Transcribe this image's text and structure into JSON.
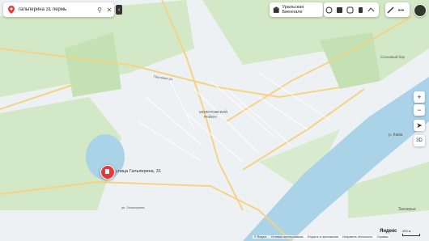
{
  "search": {
    "query": "гальперина 31 пермь"
  },
  "route_chip": {
    "label": "Уральская Биеннале"
  },
  "poi": {
    "label": "улица Гальперина, 31"
  },
  "map_labels": {
    "district": "МОЛОТОВСКИЙ РАЙОН",
    "sub": [
      "МИКРОРАЙОН",
      "БАХАРЕВКА"
    ],
    "river": "р. Кама",
    "right_town": "Заозерье",
    "park": "Сосновый бор",
    "streets": [
      "Пихтовая ул.",
      "Ветлужская ул.",
      "ул. Гальперина",
      "ул. Каспийская",
      "Тургенева ул.",
      "Цимлянская ул.",
      "ул. Макаренко"
    ]
  },
  "footer": {
    "items": [
      "© Яндекс",
      "Условия использования",
      "Открыть в приложении",
      "Исправить неточность",
      "Справка"
    ],
    "logo": "Яндекс",
    "scale": "400 м"
  },
  "colors": {
    "accent": "#e53a3a",
    "water": "#aad3e7",
    "green": "#cfe6c3",
    "road": "#f6d987"
  }
}
